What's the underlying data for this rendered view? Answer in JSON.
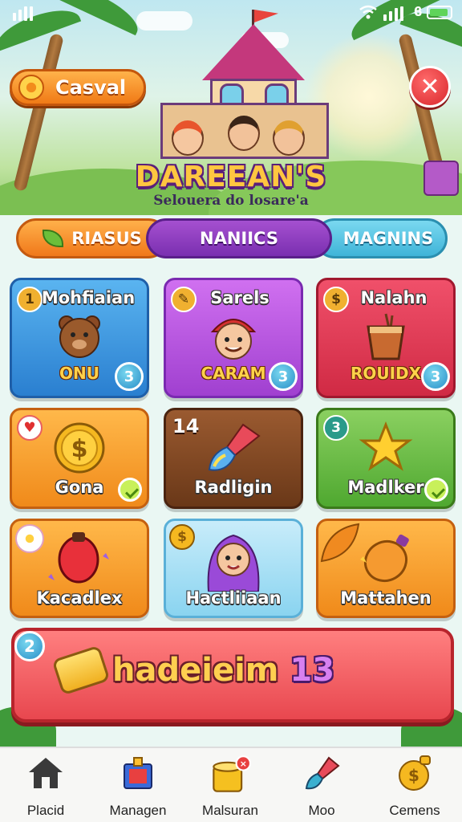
{
  "mode_button": {
    "label": "Casval"
  },
  "game": {
    "title": "DAREEAN'S",
    "subtitle": "Selouera do losare'a"
  },
  "tabs": [
    {
      "label": "RIASUS"
    },
    {
      "label": "NANIICS"
    },
    {
      "label": "MAGNINS"
    }
  ],
  "cards": [
    {
      "title": "Mohfiaian",
      "sub": "ONU",
      "badge": "3",
      "corner": "1",
      "icon": "bear-face-icon"
    },
    {
      "title": "Sarels",
      "sub": "CARAM",
      "badge": "3",
      "icon": "character-red-cap-icon"
    },
    {
      "title": "Nalahn",
      "sub": "ROUIDX",
      "badge": "3",
      "icon": "drink-cup-icon"
    },
    {
      "title": "Gona",
      "icon": "coin-icon"
    },
    {
      "title": "Radligin",
      "corner": "14",
      "icon": "paint-brush-icon"
    },
    {
      "title": "Madlker",
      "corner": "3",
      "icon": "star-icon"
    },
    {
      "title": "Kacadlex",
      "icon": "red-gem-icon"
    },
    {
      "title": "Hactliiaan",
      "icon": "purple-hair-character-icon"
    },
    {
      "title": "Mattahen",
      "icon": "orange-gem-icon"
    }
  ],
  "banner": {
    "badge": "2",
    "text": "hadeieim",
    "number": "13"
  },
  "nav": [
    {
      "label": "Placid",
      "icon": "home-icon"
    },
    {
      "label": "Managen",
      "icon": "gift-box-icon"
    },
    {
      "label": "Malsuran",
      "icon": "treasure-pot-icon"
    },
    {
      "label": "Moo",
      "icon": "paint-brush-icon"
    },
    {
      "label": "Cemens",
      "icon": "coin-bag-icon"
    }
  ],
  "colors": {
    "accent_orange": "#f07a16",
    "accent_purple": "#7a2fb0",
    "accent_cyan": "#3fb4d8",
    "banner_red": "#e8474f"
  }
}
